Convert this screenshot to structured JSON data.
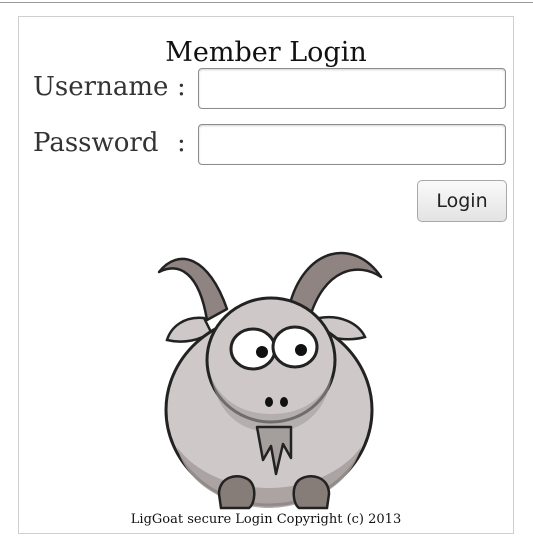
{
  "login": {
    "title": "Member Login",
    "username_label": "Username",
    "password_label": "Password",
    "colon": ":",
    "username_value": "",
    "password_value": "",
    "login_button": "Login",
    "footer": "LigGoat secure Login Copyright (c) 2013"
  },
  "colors": {
    "panel_border": "#cfcfcf",
    "goat_body": "#cec9c8",
    "goat_shadow": "#a49e9c",
    "goat_horn": "#8f8481",
    "goat_hoof": "#867c78"
  },
  "icons": [
    "goat-mascot-icon"
  ]
}
